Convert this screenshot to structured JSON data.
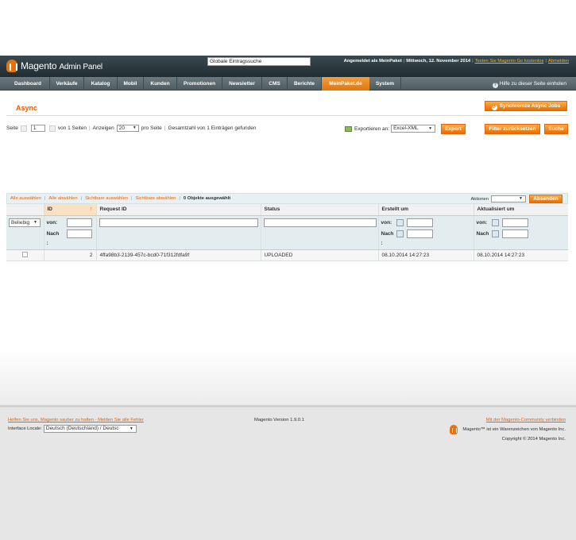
{
  "header": {
    "logo_text": "Magento",
    "logo_sub": "Admin Panel",
    "global_search_placeholder": "Globale Eintragssuche",
    "logged_in": "Angemeldet als MeinPaket",
    "date": "Mittwoch, 12. November 2014",
    "try_link": "Testen Sie Magento Go kostenlos",
    "logout_link": "Abmelden"
  },
  "nav": {
    "items": [
      "Dashboard",
      "Verkäufe",
      "Katalog",
      "Mobil",
      "Kunden",
      "Promotionen",
      "Newsletter",
      "CMS",
      "Berichte",
      "MeinPaket.de",
      "System"
    ],
    "active": "MeinPaket.de",
    "help": "Hilfe zu dieser Seite einholen"
  },
  "page": {
    "title": "Async",
    "sync_button": "Synchronize Async Jobs"
  },
  "pager": {
    "page_label": "Seite",
    "page_value": "1",
    "of_pages": "von 1 Seiten",
    "show_label": "Anzeigen",
    "per_page": "20",
    "per_page_label": "pro Seite",
    "total": "Gesamtzahl von 1 Einträgen gefunden"
  },
  "export": {
    "label": "Exportieren an:",
    "format": "Excel-XML",
    "button": "Export"
  },
  "actions": {
    "filter_reset": "Filter zurücksetzen",
    "search": "Suche"
  },
  "massaction": {
    "select_all": "Alle auswählen",
    "unselect_all": "Alle abwählen",
    "select_visible": "Sichtbare auswählen",
    "unselect_visible": "Sichtbare abwählen",
    "count": "0 Objekte ausgewählt",
    "actions_label": "Aktionen",
    "submit": "Absenden"
  },
  "grid": {
    "columns": [
      "",
      "ID",
      "Request ID",
      "Status",
      "Erstellt um",
      "Aktualisiert um"
    ],
    "filter": {
      "any": "Beliebig",
      "from": "von:",
      "to": "Nach",
      "to_colon": ":"
    },
    "rows": [
      {
        "id": "2",
        "request_id": "4ffa98b3-2139-457c-bcd0-71f312fdfa9f",
        "status": "UPLOADED",
        "created": "08.10.2014 14:27:23",
        "updated": "08.10.2014 14:27:23"
      }
    ]
  },
  "footer": {
    "help_link": "Helfen Sie uns, Magento sauber zu halten - Melden Sie alle Fehler",
    "locale_label": "Interface Locale:",
    "locale_value": "Deutsch (Deutschland) / Deutsc",
    "version": "Magento Version 1.9.0.1",
    "community_link": "Mit der Magento-Community verbinden",
    "trademark": "Magento™ ist ein Warenzeichen von Magento Inc.",
    "copyright": "Copyright © 2014 Magento Inc."
  },
  "colors": {
    "accent": "#eb5e00",
    "header_bg": "#2c3a40",
    "nav_bg": "#5e6c71",
    "active_tab": "#e98a25"
  }
}
